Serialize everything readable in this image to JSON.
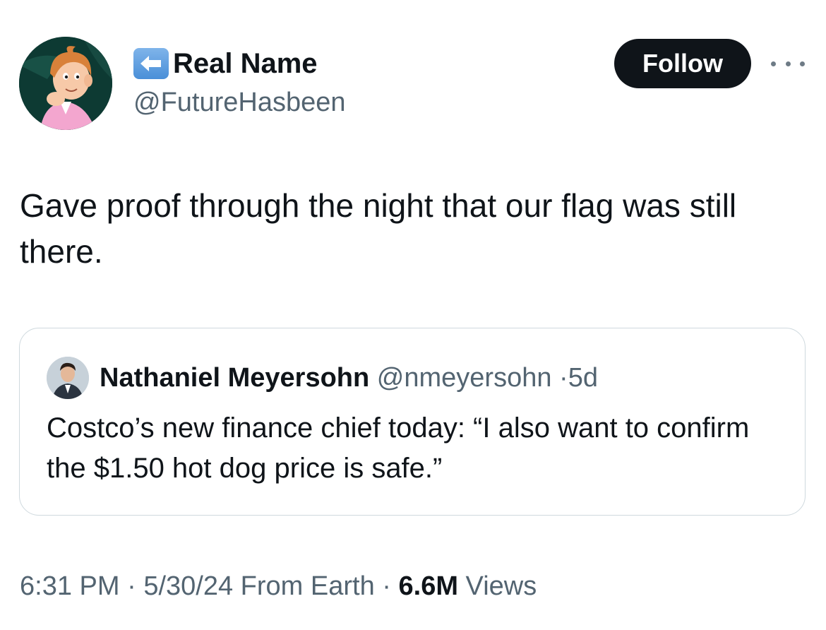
{
  "author": {
    "display_name": "Real Name",
    "handle": "@FutureHasbeen",
    "name_badge_icon": "left-arrow-icon",
    "avatar": "cartoon-character-avatar"
  },
  "actions": {
    "follow_label": "Follow",
    "more_icon": "more-options-icon"
  },
  "tweet": {
    "text": "Gave proof through the night that our flag was still there."
  },
  "quoted_tweet": {
    "author_name": "Nathaniel Meyersohn",
    "handle": "@nmeyersohn",
    "separator": "·",
    "age": "5d",
    "text": "Costco’s new finance chief today: “I also want to confirm the $1.50 hot dog price is safe.”"
  },
  "meta": {
    "time": "6:31 PM",
    "sep1": "·",
    "date": "5/30/24",
    "source": "From Earth",
    "sep2": "·",
    "views_count": "6.6M",
    "views_label": "Views"
  },
  "colors": {
    "text_primary": "#0f1419",
    "text_secondary": "#536471",
    "border": "#cfd9de",
    "button_bg": "#0f1419",
    "badge_blue": "#4a8fd8"
  }
}
